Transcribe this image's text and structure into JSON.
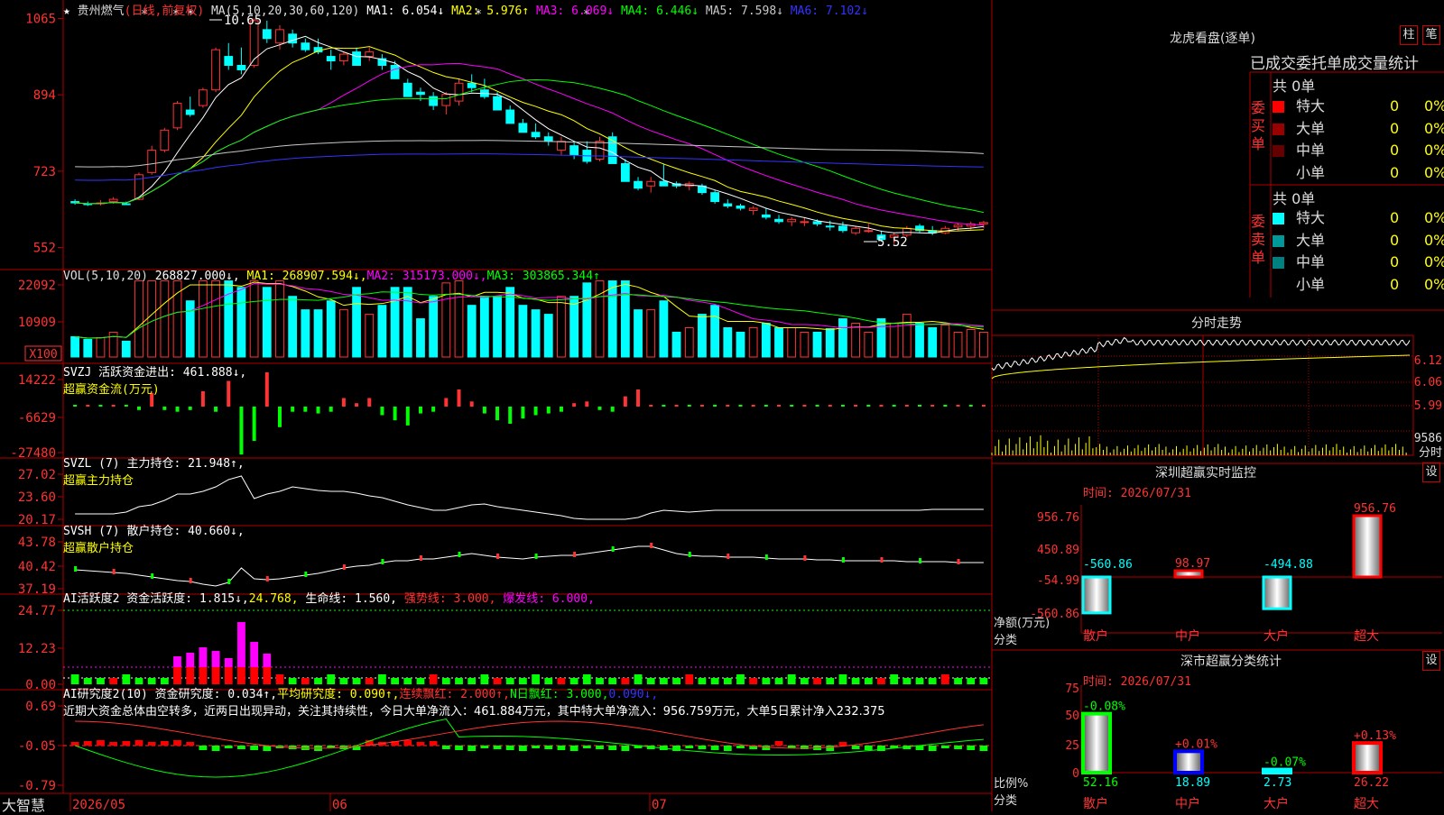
{
  "stock": {
    "title": "贵州燃气",
    "period": "(日线,前复权)",
    "current": "6.054"
  },
  "main": {
    "ma_label": "MA(5,10,20,30,60,120)",
    "ma": [
      {
        "name": "MA1:",
        "val": "6.054",
        "arrow": "↓",
        "color": "#ffffff"
      },
      {
        "name": "MA2:",
        "val": "5.976",
        "arrow": "↑",
        "color": "#ffff00"
      },
      {
        "name": "MA3:",
        "val": "6.069",
        "arrow": "↓",
        "color": "#ff00ff"
      },
      {
        "name": "MA4:",
        "val": "6.446",
        "arrow": "↓",
        "color": "#00ff00"
      },
      {
        "name": "MA5:",
        "val": "7.598",
        "arrow": "↓",
        "color": "#c8c8c8"
      },
      {
        "name": "MA6:",
        "val": "7.102",
        "arrow": "↓",
        "color": "#3333ff"
      }
    ],
    "yticks": [
      "1065",
      "894",
      "723",
      "552"
    ],
    "high_label": "10.65",
    "low_label": "5.52"
  },
  "vol": {
    "label": "VOL(5,10,20)",
    "value": "268827.000↓,",
    "ma": [
      {
        "name": "MA1:",
        "val": "268907.594↓,",
        "color": "#ffff00"
      },
      {
        "name": "MA2:",
        "val": "315173.000↓,",
        "color": "#ff00ff"
      },
      {
        "name": "MA3:",
        "val": "303865.344↑",
        "color": "#00ff00"
      }
    ],
    "yticks": [
      "22092",
      "10909"
    ],
    "unit": "X100"
  },
  "svzj": {
    "label": "SVZJ  活跃资金进出: 461.888↓,",
    "sub": "超赢资金流(万元)",
    "yticks": [
      "14222",
      "-6629",
      "-27480"
    ]
  },
  "svzl": {
    "label": "SVZL (7) 主力持仓: 21.948↑,",
    "sub": "超赢主力持仓",
    "yticks": [
      "27.02",
      "23.60",
      "20.17"
    ]
  },
  "svsh": {
    "label": "SVSH (7) 散户持仓: 40.660↓,",
    "sub": "超赢散户持仓",
    "yticks": [
      "43.78",
      "40.42",
      "37.19"
    ]
  },
  "ai1": {
    "label": "AI活跃度2 资金活跃度: 1.815↓,",
    "v2": "24.768,",
    "v3": "生命线: 1.560,",
    "v4": "强势线: 3.000,",
    "v5": "爆发线: 6.000,",
    "yticks": [
      "24.77",
      "12.23",
      "0.00"
    ]
  },
  "ai2": {
    "label": "AI研究度2(10) 资金研究度: 0.034↑,",
    "v2": "平均研究度: 0.090↑,",
    "v3": "连续飘红: 2.000↑,",
    "v4": "N日飘红: 3.000,",
    "v5": "0.090↓,",
    "comment": "近期大资金总体由空转多，近两日出现异动，关注其持续性，今日大单净流入：461.884万元，其中特大单净流入：956.759万元，大单5日累计净入232.375",
    "yticks": [
      "0.69",
      "-0.05",
      "-0.79"
    ]
  },
  "xaxis": {
    "labels": [
      "2026/05",
      "06",
      "07"
    ],
    "brand": "大智慧"
  },
  "right": {
    "dragon_title": "龙虎看盘(逐单)",
    "btn1": "柱",
    "btn2": "笔",
    "stats_title": "已成交委托单成交量统计",
    "buy_side": "委买单",
    "sell_side": "委卖单",
    "buy_total": "共 0单",
    "sell_total": "共 0单",
    "buy": [
      {
        "name": "特大",
        "val": "0",
        "pct": "0%",
        "color": "#ff0000"
      },
      {
        "name": "大单",
        "val": "0",
        "pct": "0%",
        "color": "#990000"
      },
      {
        "name": "中单",
        "val": "0",
        "pct": "0%",
        "color": "#660000"
      },
      {
        "name": "小单",
        "val": "0",
        "pct": "0%",
        "color": "#000000"
      }
    ],
    "sell": [
      {
        "name": "特大",
        "val": "0",
        "pct": "0%",
        "color": "#00ffff"
      },
      {
        "name": "大单",
        "val": "0",
        "pct": "0%",
        "color": "#009999"
      },
      {
        "name": "中单",
        "val": "0",
        "pct": "0%",
        "color": "#008080"
      },
      {
        "name": "小单",
        "val": "0",
        "pct": "0%",
        "color": "#000000"
      }
    ],
    "intraday_title": "分时走势",
    "intraday_yticks": [
      "6.12",
      "6.06",
      "5.99"
    ],
    "intraday_vol": "9586",
    "intraday_unit": "分时",
    "sz_title": "深圳超赢实时监控",
    "sz_time": "时间: 2026/07/31",
    "set_btn": "设",
    "sz_yticks": [
      "956.76",
      "450.89",
      "-54.99",
      "-560.86"
    ],
    "sz_axis": "净额(万元)",
    "sz_axis2": "分类",
    "sz_cats": [
      "散户",
      "中户",
      "大户",
      "超大"
    ],
    "sz_class_title": "深市超赢分类统计",
    "sz_class_time": "时间: 2026/07/31",
    "cls_yticks": [
      "75",
      "50",
      "25",
      "0"
    ],
    "cls_axis": "比例%",
    "cls_axis2": "分类",
    "cls_cats": [
      "散户",
      "中户",
      "大户",
      "超大"
    ]
  },
  "chart_data": [
    {
      "type": "candlestick",
      "title": "贵州燃气(日线,前复权)",
      "yunits": "price×100",
      "ylim": [
        552,
        1065
      ],
      "ohlc": [
        [
          655,
          660,
          648,
          652
        ],
        [
          650,
          655,
          645,
          648
        ],
        [
          650,
          658,
          646,
          652
        ],
        [
          655,
          665,
          650,
          660
        ],
        [
          650,
          655,
          647,
          648
        ],
        [
          660,
          720,
          658,
          715
        ],
        [
          720,
          780,
          715,
          770
        ],
        [
          770,
          820,
          765,
          815
        ],
        [
          820,
          880,
          815,
          875
        ],
        [
          860,
          890,
          845,
          850
        ],
        [
          870,
          910,
          865,
          905
        ],
        [
          905,
          1000,
          900,
          995
        ],
        [
          980,
          1010,
          950,
          960
        ],
        [
          960,
          1000,
          940,
          950
        ],
        [
          960,
          1065,
          955,
          1060
        ],
        [
          1040,
          1060,
          1010,
          1020
        ],
        [
          1010,
          1050,
          995,
          1040
        ],
        [
          1030,
          1040,
          1000,
          1010
        ],
        [
          1010,
          1020,
          990,
          995
        ],
        [
          1000,
          1020,
          985,
          990
        ],
        [
          980,
          995,
          950,
          970
        ],
        [
          970,
          990,
          960,
          985
        ],
        [
          990,
          1000,
          960,
          960
        ],
        [
          980,
          1000,
          970,
          990
        ],
        [
          975,
          985,
          950,
          960
        ],
        [
          960,
          970,
          930,
          930
        ],
        [
          920,
          930,
          890,
          890
        ],
        [
          900,
          910,
          880,
          895
        ],
        [
          890,
          900,
          860,
          870
        ],
        [
          870,
          900,
          850,
          895
        ],
        [
          880,
          930,
          870,
          920
        ],
        [
          920,
          940,
          900,
          910
        ],
        [
          905,
          930,
          885,
          890
        ],
        [
          890,
          900,
          870,
          860
        ],
        [
          860,
          870,
          830,
          830
        ],
        [
          830,
          840,
          810,
          810
        ],
        [
          810,
          830,
          795,
          800
        ],
        [
          800,
          810,
          780,
          790
        ],
        [
          770,
          800,
          760,
          790
        ],
        [
          780,
          790,
          750,
          760
        ],
        [
          770,
          790,
          740,
          745
        ],
        [
          750,
          800,
          745,
          790
        ],
        [
          800,
          810,
          740,
          740
        ],
        [
          740,
          750,
          700,
          700
        ],
        [
          700,
          710,
          680,
          685
        ],
        [
          690,
          710,
          675,
          700
        ],
        [
          700,
          740,
          695,
          690
        ],
        [
          695,
          700,
          685,
          690
        ],
        [
          690,
          700,
          680,
          695
        ],
        [
          690,
          695,
          670,
          675
        ],
        [
          675,
          680,
          650,
          655
        ],
        [
          650,
          660,
          640,
          645
        ],
        [
          645,
          650,
          635,
          640
        ],
        [
          635,
          645,
          625,
          640
        ],
        [
          625,
          640,
          615,
          620
        ],
        [
          615,
          625,
          605,
          610
        ],
        [
          610,
          620,
          600,
          615
        ],
        [
          610,
          620,
          600,
          610
        ],
        [
          610,
          615,
          600,
          605
        ],
        [
          600,
          612,
          590,
          598
        ],
        [
          600,
          610,
          585,
          590
        ],
        [
          585,
          600,
          580,
          595
        ],
        [
          590,
          605,
          585,
          590
        ],
        [
          580,
          590,
          565,
          570
        ],
        [
          575,
          585,
          560,
          580
        ],
        [
          580,
          600,
          575,
          595
        ],
        [
          600,
          605,
          585,
          590
        ],
        [
          590,
          600,
          580,
          585
        ],
        [
          585,
          600,
          582,
          595
        ],
        [
          598,
          606,
          590,
          602
        ],
        [
          600,
          610,
          592,
          605
        ],
        [
          605,
          612,
          595,
          608
        ]
      ]
    }
  ]
}
